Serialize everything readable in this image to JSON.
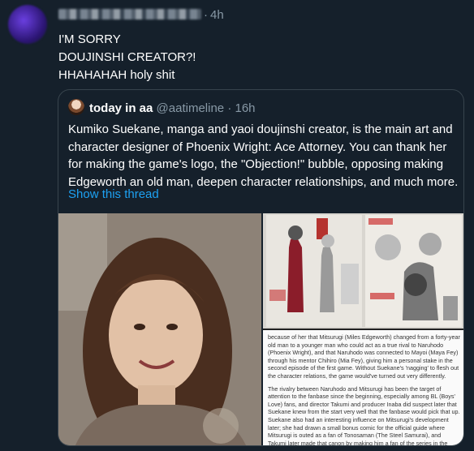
{
  "tweet": {
    "time": "4h",
    "lines": [
      "I'M SORRY",
      "DOUJINSHI CREATOR?!",
      "HHAHAHAH holy shit"
    ]
  },
  "quoted": {
    "display_name": "today in aa",
    "handle": "@aatimeline",
    "time": "16h",
    "text_lines": [
      "Kumiko Suekane, manga and yaoi doujinshi creator, is the main art and",
      "character designer of Phoenix Wright: Ace Attorney. You can thank her",
      "for making the game's logo, the \"Objection!\" bubble, opposing making",
      "Edgeworth an old man, deepen character relationships, and much more."
    ],
    "show_thread": "Show this thread",
    "caption_paragraphs": [
      "because of her that Mitsurugi (Miles Edgeworth) changed from a forty-year old man to a younger man who could act as a true rival to Naruhodo (Phoenix Wright), and that Naruhodo was connected to Mayoi (Maya Fey) through his mentor Chihiro (Mia Fey), giving him a personal stake in the second episode of the first game. Without Suekane's 'nagging' to flesh out the character relations, the game would've turned out very differently.",
      "The rivalry between Naruhodo and Mitsurugi has been the target of attention to the fanbase since the beginning, especially among BL (Boys' Love) fans, and director Takumi and producer Inaba did suspect later that Suekane knew from the start very well that the fanbase would pick that up. Suekane also had an interesting influence on Mitsurugi's development later; she had drawn a small bonus comic for the official guide where Mitsurugi is outed as a fan of Tonosaman (The Steel Samurai), and Takumi later made that canon by making him a fan of the series in the games too."
    ]
  }
}
